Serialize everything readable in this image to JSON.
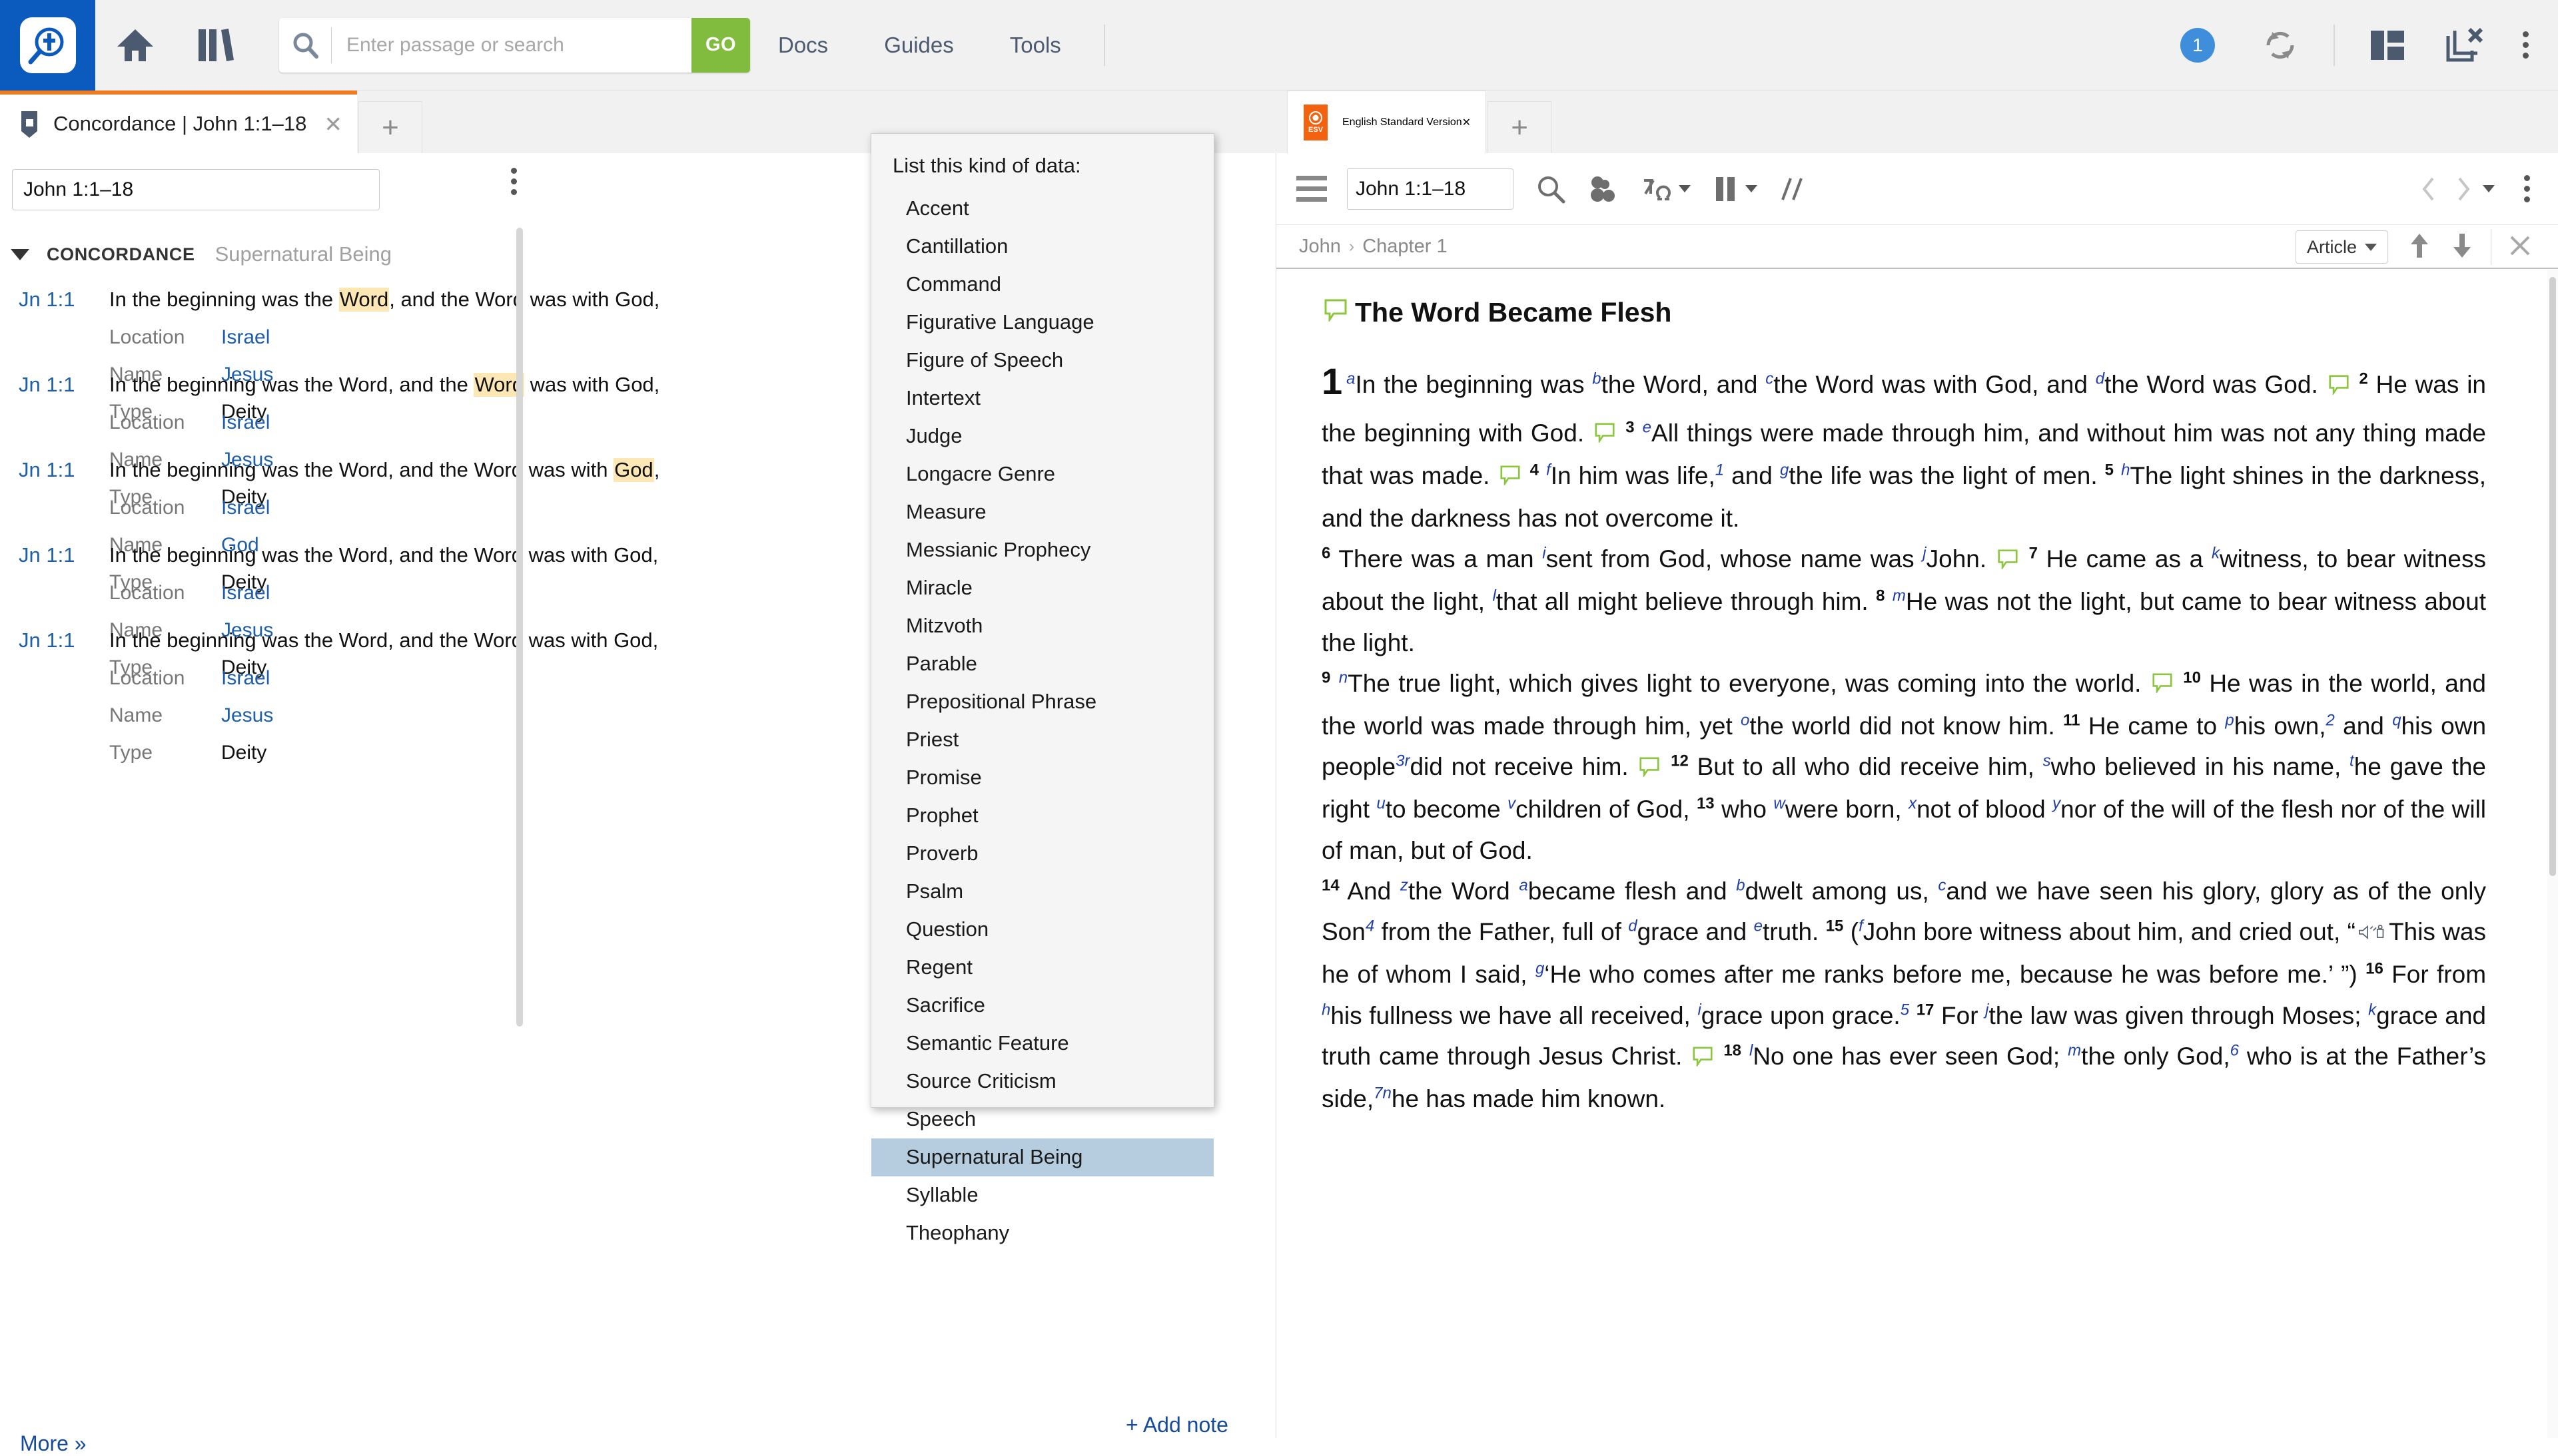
{
  "topbar": {
    "logo_name": "logos-app-logo",
    "home_label": "Home",
    "library_label": "Library",
    "search": {
      "placeholder": "Enter passage or search",
      "value": "",
      "go_label": "GO"
    },
    "links": [
      "Docs",
      "Guides",
      "Tools"
    ],
    "notification_count": "1"
  },
  "left_panel": {
    "tab": {
      "title": "Concordance | John 1:1–18",
      "close": "✕",
      "new_tab": "+"
    },
    "reference_input": {
      "value": "John 1:1–18"
    },
    "section": {
      "title": "CONCORDANCE",
      "subtitle": "Supernatural Being"
    },
    "attr_labels": {
      "location": "Location",
      "name": "Name",
      "type": "Type"
    },
    "entries": [
      {
        "ref": "Jn 1:1",
        "pre": "In the beginning was the ",
        "hl": "Word",
        "post": ", and the Word was with God,",
        "location": "Israel",
        "name": "Jesus",
        "type": "Deity"
      },
      {
        "ref": "Jn 1:1",
        "pre": "In the beginning was the Word, and the ",
        "hl": "Word",
        "post": " was with God,",
        "location": "Israel",
        "name": "Jesus",
        "type": "Deity"
      },
      {
        "ref": "Jn 1:1",
        "pre": "In the beginning was the Word, and the Word was with ",
        "hl": "God",
        "post": ",",
        "location": "Israel",
        "name": "God",
        "type": "Deity"
      },
      {
        "ref": "Jn 1:1",
        "pre": "In the beginning was the Word, and the Word was with God,",
        "hl": "",
        "post": "",
        "location": "Israel",
        "name": "Jesus",
        "type": "Deity"
      },
      {
        "ref": "Jn 1:1",
        "pre": "In the beginning was the Word, and the Word was with God,",
        "hl": "",
        "post": "",
        "location": "Israel",
        "name": "Jesus",
        "type": "Deity"
      }
    ],
    "more_label": "More »"
  },
  "menu": {
    "title": "List this kind of data:",
    "selected": "Supernatural Being",
    "items": [
      "Accent",
      "Cantillation",
      "Command",
      "Figurative Language",
      "Figure of Speech",
      "Intertext",
      "Judge",
      "Longacre Genre",
      "Measure",
      "Messianic Prophecy",
      "Miracle",
      "Mitzvoth",
      "Parable",
      "Prepositional Phrase",
      "Priest",
      "Promise",
      "Prophet",
      "Proverb",
      "Psalm",
      "Question",
      "Regent",
      "Sacrifice",
      "Semantic Feature",
      "Source Criticism",
      "Speech",
      "Supernatural Being",
      "Syllable",
      "Theophany"
    ]
  },
  "add_note_label": "+ Add note",
  "right_panel": {
    "tab": {
      "title": "English Standard Version",
      "icon_label": "ESV",
      "close": "✕",
      "new_tab": "+"
    },
    "reference_input": {
      "value": "John 1:1–18"
    },
    "breadcrumb": {
      "book": "John",
      "sep": "›",
      "chapter": "Chapter 1"
    },
    "article_button": "Article",
    "heading": "The Word Became Flesh",
    "verses": [
      {
        "n": "1",
        "chapter": "1",
        "parts": [
          {
            "t": "xr",
            "v": "a"
          },
          {
            "t": "txt",
            "v": "In the beginning was "
          },
          {
            "t": "xr",
            "v": "b"
          },
          {
            "t": "txt",
            "v": "the Word, and "
          },
          {
            "t": "xr",
            "v": "c"
          },
          {
            "t": "txt",
            "v": "the Word was with God, and "
          },
          {
            "t": "xr",
            "v": "d"
          },
          {
            "t": "txt",
            "v": "the Word was God. "
          },
          {
            "t": "bubble"
          }
        ]
      },
      {
        "n": "2",
        "parts": [
          {
            "t": "txt",
            "v": "He was in the beginning with God. "
          },
          {
            "t": "bubble"
          }
        ]
      },
      {
        "n": "3",
        "parts": [
          {
            "t": "xr",
            "v": "e"
          },
          {
            "t": "txt",
            "v": "All things were made through him, and without him was not any thing made that was made. "
          },
          {
            "t": "bubble"
          }
        ]
      },
      {
        "n": "4",
        "parts": [
          {
            "t": "xr",
            "v": "f"
          },
          {
            "t": "txt",
            "v": "In him was life,"
          },
          {
            "t": "fn",
            "v": "1"
          },
          {
            "t": "txt",
            "v": " and "
          },
          {
            "t": "xr",
            "v": "g"
          },
          {
            "t": "txt",
            "v": "the life was the light of men. "
          }
        ]
      },
      {
        "n": "5",
        "parts": [
          {
            "t": "xr",
            "v": "h"
          },
          {
            "t": "txt",
            "v": "The light shines in the darkness, and the darkness has not overcome it."
          }
        ]
      },
      {
        "n": "6",
        "para": true,
        "parts": [
          {
            "t": "txt",
            "v": "There was a man "
          },
          {
            "t": "xr",
            "v": "i"
          },
          {
            "t": "txt",
            "v": "sent from God, whose name was "
          },
          {
            "t": "xr",
            "v": "j"
          },
          {
            "t": "txt",
            "v": "John. "
          },
          {
            "t": "bubble"
          }
        ]
      },
      {
        "n": "7",
        "parts": [
          {
            "t": "txt",
            "v": "He came as a "
          },
          {
            "t": "xr",
            "v": "k"
          },
          {
            "t": "txt",
            "v": "witness, to bear witness about the light, "
          },
          {
            "t": "xr",
            "v": "l"
          },
          {
            "t": "txt",
            "v": "that all might believe through him. "
          }
        ]
      },
      {
        "n": "8",
        "parts": [
          {
            "t": "xr",
            "v": "m"
          },
          {
            "t": "txt",
            "v": "He was not the light, but came to bear witness about the light."
          }
        ]
      },
      {
        "n": "9",
        "para": true,
        "parts": [
          {
            "t": "xr",
            "v": "n"
          },
          {
            "t": "txt",
            "v": "The true light, which gives light to everyone, was coming into the world. "
          },
          {
            "t": "bubble"
          }
        ]
      },
      {
        "n": "10",
        "parts": [
          {
            "t": "txt",
            "v": "He was in the world, and the world was made through him, yet "
          },
          {
            "t": "xr",
            "v": "o"
          },
          {
            "t": "txt",
            "v": "the world did not know him. "
          }
        ]
      },
      {
        "n": "11",
        "parts": [
          {
            "t": "txt",
            "v": "He came to "
          },
          {
            "t": "xr",
            "v": "p"
          },
          {
            "t": "txt",
            "v": "his own,"
          },
          {
            "t": "fn",
            "v": "2"
          },
          {
            "t": "txt",
            "v": " and "
          },
          {
            "t": "xr",
            "v": "q"
          },
          {
            "t": "txt",
            "v": "his own people"
          },
          {
            "t": "fn",
            "v": "3"
          },
          {
            "t": "xr",
            "v": "r"
          },
          {
            "t": "txt",
            "v": "did not receive him. "
          },
          {
            "t": "bubble"
          }
        ]
      },
      {
        "n": "12",
        "parts": [
          {
            "t": "txt",
            "v": "But to all who did receive him, "
          },
          {
            "t": "xr",
            "v": "s"
          },
          {
            "t": "txt",
            "v": "who believed in his name, "
          },
          {
            "t": "xr",
            "v": "t"
          },
          {
            "t": "txt",
            "v": "he gave the right "
          },
          {
            "t": "xr",
            "v": "u"
          },
          {
            "t": "txt",
            "v": "to become "
          },
          {
            "t": "xr",
            "v": "v"
          },
          {
            "t": "txt",
            "v": "children of God, "
          }
        ]
      },
      {
        "n": "13",
        "parts": [
          {
            "t": "txt",
            "v": "who "
          },
          {
            "t": "xr",
            "v": "w"
          },
          {
            "t": "txt",
            "v": "were born, "
          },
          {
            "t": "xr",
            "v": "x"
          },
          {
            "t": "txt",
            "v": "not of blood "
          },
          {
            "t": "xr",
            "v": "y"
          },
          {
            "t": "txt",
            "v": "nor of the will of the flesh nor of the will of man, but of God."
          }
        ]
      },
      {
        "n": "14",
        "para": true,
        "parts": [
          {
            "t": "txt",
            "v": "And "
          },
          {
            "t": "xr",
            "v": "z"
          },
          {
            "t": "txt",
            "v": "the Word "
          },
          {
            "t": "xr",
            "v": "a"
          },
          {
            "t": "txt",
            "v": "became flesh and "
          },
          {
            "t": "xr",
            "v": "b"
          },
          {
            "t": "txt",
            "v": "dwelt among us, "
          },
          {
            "t": "xr",
            "v": "c"
          },
          {
            "t": "txt",
            "v": "and we have seen his glory, glory as of the only Son"
          },
          {
            "t": "fn",
            "v": "4"
          },
          {
            "t": "txt",
            "v": " from the Father, full of "
          },
          {
            "t": "xr",
            "v": "d"
          },
          {
            "t": "txt",
            "v": "grace and "
          },
          {
            "t": "xr",
            "v": "e"
          },
          {
            "t": "txt",
            "v": "truth. "
          }
        ]
      },
      {
        "n": "15",
        "parts": [
          {
            "t": "txt",
            "v": "("
          },
          {
            "t": "xr",
            "v": "f"
          },
          {
            "t": "txt",
            "v": "John bore witness about him, and cried out, “"
          },
          {
            "t": "speaker"
          },
          {
            "t": "txt",
            "v": "This was he of whom I said, "
          },
          {
            "t": "xr",
            "v": "g"
          },
          {
            "t": "txt",
            "v": "‘He who comes after me ranks before me, because he was before me.’ ”) "
          }
        ]
      },
      {
        "n": "16",
        "parts": [
          {
            "t": "txt",
            "v": "For from "
          },
          {
            "t": "xr",
            "v": "h"
          },
          {
            "t": "txt",
            "v": "his fullness we have all received, "
          },
          {
            "t": "xr",
            "v": "i"
          },
          {
            "t": "txt",
            "v": "grace upon grace."
          },
          {
            "t": "fn",
            "v": "5"
          },
          {
            "t": "txt",
            "v": " "
          }
        ]
      },
      {
        "n": "17",
        "parts": [
          {
            "t": "txt",
            "v": "For "
          },
          {
            "t": "xr",
            "v": "j"
          },
          {
            "t": "txt",
            "v": "the law was given through Moses; "
          },
          {
            "t": "xr",
            "v": "k"
          },
          {
            "t": "txt",
            "v": "grace and truth came through Jesus Christ. "
          },
          {
            "t": "bubble"
          }
        ]
      },
      {
        "n": "18",
        "parts": [
          {
            "t": "xr",
            "v": "l"
          },
          {
            "t": "txt",
            "v": "No one has ever seen God; "
          },
          {
            "t": "xr",
            "v": "m"
          },
          {
            "t": "txt",
            "v": "the only God,"
          },
          {
            "t": "fn",
            "v": "6"
          },
          {
            "t": "txt",
            "v": " who is at the Father’s side,"
          },
          {
            "t": "fn",
            "v": "7"
          },
          {
            "t": "xr",
            "v": "n"
          },
          {
            "t": "txt",
            "v": "he has made him known."
          }
        ]
      }
    ]
  },
  "colors": {
    "brand_blue": "#0a5bbd",
    "go_green": "#82bc3e",
    "tab_accent_orange": "#f07c21",
    "link_blue": "#1f5fa8",
    "highlight_yellow": "#fde7b4",
    "menu_selected": "#b5cddf",
    "esv_orange": "#f2620f",
    "bubble_green": "#8cc63f"
  }
}
